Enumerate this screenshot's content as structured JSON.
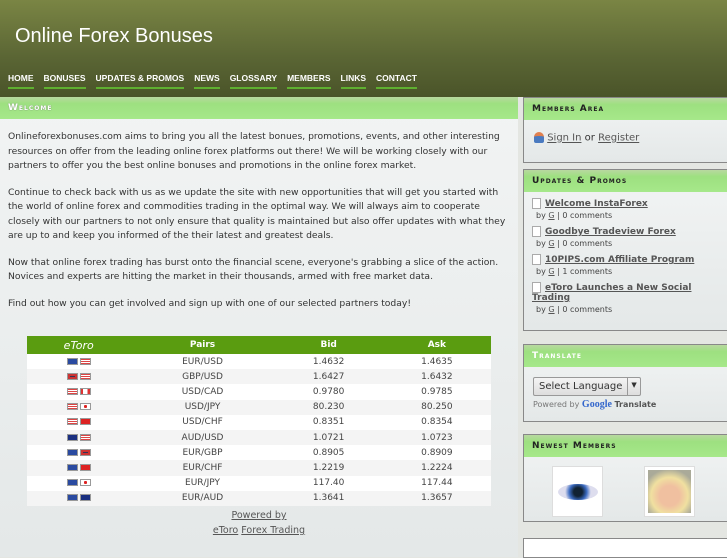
{
  "site_title": "Online Forex Bonuses",
  "nav": [
    "HOME",
    "BONUSES",
    "UPDATES & PROMOS",
    "NEWS",
    "GLOSSARY",
    "MEMBERS",
    "LINKS",
    "CONTACT"
  ],
  "main": {
    "heading": "Welcome",
    "paragraphs": [
      "Onlineforexbonuses.com aims to bring you all the latest bonues, promotions, events, and other interesting resources on offer from the leading online forex platforms out there!  We will be working closely with our partners to offer you the best online bonuses and promotions in the online forex market.",
      "Continue to check back with us as we update the site with new opportunities that will get you started with the world of online forex and commodities trading in the optimal way.  We will always aim to cooperate closely with our partners to not only ensure that quality is maintained but also offer updates with what they are up to and keep you informed of the their latest and greatest deals.",
      "Now that online forex trading has burst onto the financial scene, everyone's grabbing a slice of the action. Novices and experts are hitting the market in their thousands, armed with free market data.",
      "Find out how you can get involved and sign up with one of our selected partners today!"
    ]
  },
  "rates": {
    "logo": "eToro",
    "headers": [
      "Pairs",
      "Bid",
      "Ask"
    ],
    "rows": [
      {
        "flags": [
          "eu",
          "us"
        ],
        "pair": "EUR/USD",
        "bid": "1.4632",
        "ask": "1.4635"
      },
      {
        "flags": [
          "gb",
          "us"
        ],
        "pair": "GBP/USD",
        "bid": "1.6427",
        "ask": "1.6432"
      },
      {
        "flags": [
          "us",
          "ca"
        ],
        "pair": "USD/CAD",
        "bid": "0.9780",
        "ask": "0.9785"
      },
      {
        "flags": [
          "us",
          "jp"
        ],
        "pair": "USD/JPY",
        "bid": "80.230",
        "ask": "80.250"
      },
      {
        "flags": [
          "us",
          "ch"
        ],
        "pair": "USD/CHF",
        "bid": "0.8351",
        "ask": "0.8354"
      },
      {
        "flags": [
          "au",
          "us"
        ],
        "pair": "AUD/USD",
        "bid": "1.0721",
        "ask": "1.0723"
      },
      {
        "flags": [
          "eu",
          "gb"
        ],
        "pair": "EUR/GBP",
        "bid": "0.8905",
        "ask": "0.8909"
      },
      {
        "flags": [
          "eu",
          "ch"
        ],
        "pair": "EUR/CHF",
        "bid": "1.2219",
        "ask": "1.2224"
      },
      {
        "flags": [
          "eu",
          "jp"
        ],
        "pair": "EUR/JPY",
        "bid": "117.40",
        "ask": "117.44"
      },
      {
        "flags": [
          "eu",
          "au"
        ],
        "pair": "EUR/AUD",
        "bid": "1.3641",
        "ask": "1.3657"
      }
    ],
    "powered_by": "Powered by",
    "etoro_link": "eToro",
    "forex_link": "Forex Trading"
  },
  "members": {
    "heading": "Members Area",
    "sign_in": "Sign In",
    "or": "or",
    "register": "Register"
  },
  "updates": {
    "heading": "Updates & Promos",
    "items": [
      {
        "title": "Welcome InstaForex",
        "by": "by",
        "author": "G",
        "comments": "| 0 comments"
      },
      {
        "title": "Goodbye Tradeview Forex",
        "by": "by",
        "author": "G",
        "comments": "| 0 comments"
      },
      {
        "title": "10PIPS.com Affiliate Program",
        "by": "by",
        "author": "G",
        "comments": "| 1 comments"
      },
      {
        "title": "eToro Launches a New Social Trading",
        "by": "by",
        "author": "G",
        "comments": "| 0 comments"
      }
    ]
  },
  "translate": {
    "heading": "Translate",
    "select": "Select Language",
    "powered": "Powered by",
    "google": "Google",
    "translate": "Translate"
  },
  "newest": {
    "heading": "Newest Members"
  }
}
